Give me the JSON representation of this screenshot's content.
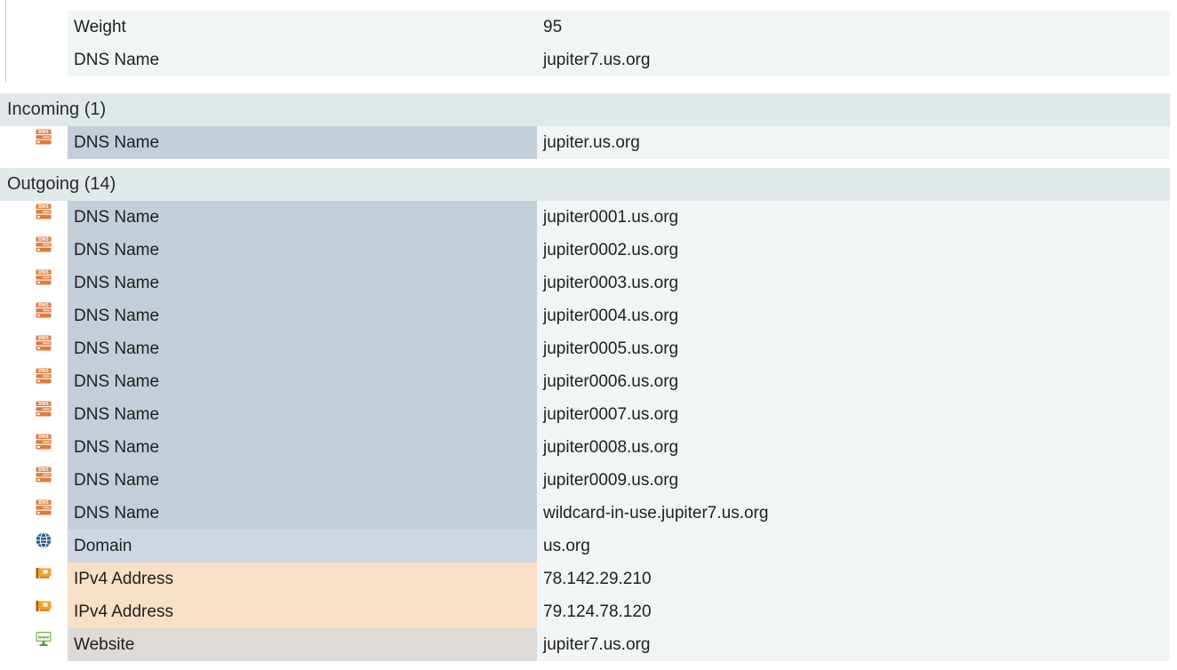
{
  "properties": [
    {
      "label": "Weight",
      "value": "95"
    },
    {
      "label": "DNS Name",
      "value": "jupiter7.us.org"
    }
  ],
  "incoming": {
    "title": "Incoming (1)",
    "rows": [
      {
        "icon": "dns-server-icon",
        "type": "dns",
        "label": "DNS Name",
        "value": "jupiter.us.org"
      }
    ]
  },
  "outgoing": {
    "title": "Outgoing (14)",
    "rows": [
      {
        "icon": "dns-server-icon",
        "type": "dns",
        "label": "DNS Name",
        "value": "jupiter0001.us.org"
      },
      {
        "icon": "dns-server-icon",
        "type": "dns",
        "label": "DNS Name",
        "value": "jupiter0002.us.org"
      },
      {
        "icon": "dns-server-icon",
        "type": "dns",
        "label": "DNS Name",
        "value": "jupiter0003.us.org"
      },
      {
        "icon": "dns-server-icon",
        "type": "dns",
        "label": "DNS Name",
        "value": "jupiter0004.us.org"
      },
      {
        "icon": "dns-server-icon",
        "type": "dns",
        "label": "DNS Name",
        "value": "jupiter0005.us.org"
      },
      {
        "icon": "dns-server-icon",
        "type": "dns",
        "label": "DNS Name",
        "value": "jupiter0006.us.org"
      },
      {
        "icon": "dns-server-icon",
        "type": "dns",
        "label": "DNS Name",
        "value": "jupiter0007.us.org"
      },
      {
        "icon": "dns-server-icon",
        "type": "dns",
        "label": "DNS Name",
        "value": "jupiter0008.us.org"
      },
      {
        "icon": "dns-server-icon",
        "type": "dns",
        "label": "DNS Name",
        "value": "jupiter0009.us.org"
      },
      {
        "icon": "dns-server-icon",
        "type": "dns",
        "label": "DNS Name",
        "value": "wildcard-in-use.jupiter7.us.org"
      },
      {
        "icon": "globe-icon",
        "type": "domain",
        "label": "Domain",
        "value": "us.org"
      },
      {
        "icon": "network-card-icon",
        "type": "ipv4",
        "label": "IPv4 Address",
        "value": "78.142.29.210"
      },
      {
        "icon": "network-card-icon",
        "type": "ipv4",
        "label": "IPv4 Address",
        "value": "79.124.78.120"
      },
      {
        "icon": "website-monitor-icon",
        "type": "website",
        "label": "Website",
        "value": "jupiter7.us.org"
      }
    ]
  },
  "colors": {
    "dns": "#c4ced8",
    "domain": "#cdd6e1",
    "ipv4": "#f8dfc6",
    "website": "#dddad8",
    "row_bg": "#f2f5f6",
    "header_bg": "#e1e8ea",
    "dns_icon": "#e07a3a",
    "globe_icon": "#2f5b8f",
    "nic_icon": "#f2a12c",
    "www_icon": "#7ab648"
  }
}
